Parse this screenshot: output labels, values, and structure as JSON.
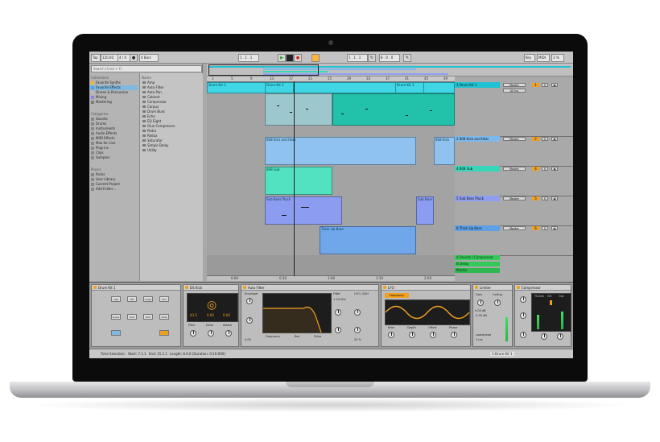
{
  "transport": {
    "tap": "Tap",
    "tempo": "120.00",
    "time_sig": "4 / 4",
    "quantize": "4 Bars",
    "position": "1 . 1 . 1",
    "loop_start": "1 . 1 . 1",
    "loop_length": "8 . 0 . 0",
    "key_label": "Key",
    "midi_label": "MIDI",
    "cpu": "3 %"
  },
  "browser": {
    "search_placeholder": "Search (Cmd + F)",
    "collections_header": "Collections",
    "collections": [
      {
        "label": "Favorite Synths",
        "color": "#f2b531"
      },
      {
        "label": "Favorite Effects",
        "color": "#5aa0e0"
      },
      {
        "label": "Drums & Percussion",
        "color": "#b9b9b9"
      },
      {
        "label": "Mixing",
        "color": "#9a7ee0"
      },
      {
        "label": "Mastering",
        "color": "#7e7e7e"
      }
    ],
    "categories_header": "Categories",
    "categories": [
      "Sounds",
      "Drums",
      "Instruments",
      "Audio Effects",
      "MIDI Effects",
      "Max for Live",
      "Plug-ins",
      "Clips",
      "Samples"
    ],
    "places_header": "Places",
    "places": [
      "Packs",
      "User Library",
      "Current Project",
      "Add Folder…"
    ],
    "files_header": "Name",
    "files": [
      "Amp",
      "Auto Filter",
      "Auto Pan",
      "Cabinet",
      "Compressor",
      "Corpus",
      "Drum Buss",
      "Echo",
      "EQ Eight",
      "Glue Compressor",
      "Pedal",
      "Redux",
      "Saturator",
      "Simple Delay",
      "Utility"
    ]
  },
  "arrangement": {
    "ruler": [
      "1",
      "5",
      "9",
      "13",
      "17",
      "21",
      "25",
      "29",
      "33",
      "37",
      "41",
      "45",
      "49"
    ],
    "bottom_ruler": [
      "0:00",
      "0:30",
      "1:00",
      "1:30",
      "2:00"
    ],
    "clips": {
      "drum1": "Drum Kit 1",
      "drum2": "Drum Kit 2",
      "drum3": "Drum Kit 3",
      "beats": "808 Kick and Hats",
      "beats2": "808 Kick",
      "sub": "808 Sub",
      "bass": "Sub Bass Pluck",
      "bass2": "Sub Bass",
      "pulse": "Thick Up Bass"
    }
  },
  "tracks": [
    {
      "name": "1 Drum Kit 1",
      "color": "#1fc2d2",
      "num": "1"
    },
    {
      "name": "2 808 Kick and Hats",
      "color": "#7cb8ea",
      "num": "2"
    },
    {
      "name": "4 808 Sub",
      "color": "#37d6ba",
      "num": "4"
    },
    {
      "name": "5 Sub Bass Pluck",
      "color": "#8f9ef0",
      "num": "5"
    },
    {
      "name": "6 Thick Up Bass",
      "color": "#5f9fe6",
      "num": "6"
    }
  ],
  "return_tracks": [
    "A Reverb | Compressor",
    "B Delay",
    "Master"
  ],
  "track_controls": {
    "solo": "S",
    "mute_icon": "◉",
    "out": "Master",
    "in": "All Ins"
  },
  "devices": [
    {
      "title": "Drum Kit 1",
      "pads": [
        "Clap",
        "HH",
        "Crash",
        "Tom",
        "Snare",
        "Kick",
        "Rim",
        "Ride"
      ]
    },
    {
      "title": "DS Kick",
      "readouts": [
        "43.5",
        "0.00",
        "0.00"
      ],
      "labels": [
        "Pitch",
        "Drive",
        "Attack"
      ]
    },
    {
      "title": "Auto Filter",
      "labels": [
        "Envelope",
        "Filter",
        "LFO / S&H",
        "Frequency",
        "Res",
        "Drive"
      ],
      "values": [
        "0.00",
        "1.10 kHz",
        "20 %"
      ]
    },
    {
      "title": "LFO",
      "mode": "Frequency",
      "labels": [
        "Rate",
        "Depth",
        "Offset",
        "Phase"
      ]
    },
    {
      "title": "Limiter",
      "labels": [
        "Gain",
        "Ceiling",
        "Lookahead"
      ],
      "values": [
        "0.00 dB",
        "-0.30 dB",
        "3 ms"
      ]
    },
    {
      "title": "Compressor",
      "labels": [
        "Thresh",
        "GR",
        "Out"
      ]
    }
  ],
  "status": {
    "selection": "Time Selection:",
    "start": "Start: 7.1.1",
    "end": "End: 15.1.1",
    "length": "Length: 8.0.0 (Duration: 0:16:000)",
    "track_name": "1-Drum Kit 1"
  }
}
